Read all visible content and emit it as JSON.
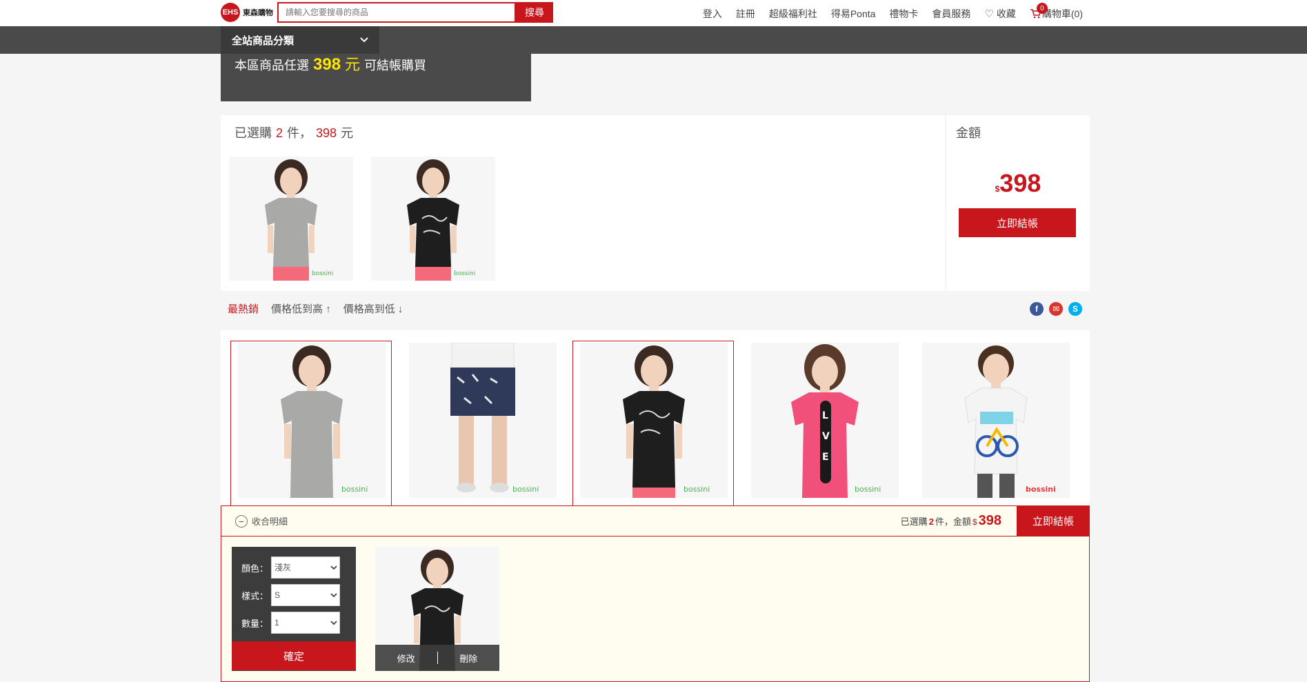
{
  "header": {
    "logo_badge": "EHS",
    "logo_text": "東森購物",
    "search_placeholder": "請輸入您要搜尋的商品",
    "search_button": "搜尋",
    "nav": [
      "登入",
      "註冊",
      "超級福利社",
      "得易Ponta",
      "禮物卡",
      "會員服務"
    ],
    "favorite": "收藏",
    "cart_count": "0",
    "cart_label": "購物車(0)"
  },
  "category": {
    "label": "全站商品分類"
  },
  "promo": {
    "prefix": "本區商品任選",
    "amount": "398",
    "unit": "元",
    "suffix": "可結帳購買"
  },
  "selected": {
    "prefix": "已選購",
    "count": "2",
    "count_unit": "件，",
    "total": "398",
    "total_unit": "元"
  },
  "amount_panel": {
    "label": "金額",
    "currency": "$",
    "value": "398",
    "checkout": "立即結帳"
  },
  "sort": [
    {
      "label": "最熱銷",
      "active": true
    },
    {
      "label": "價格低到高",
      "arrow": "↑",
      "active": false
    },
    {
      "label": "價格高到低",
      "arrow": "↓",
      "active": false
    }
  ],
  "share": [
    "f",
    "✉",
    "S"
  ],
  "products": [
    {
      "shirt": "#a9aaa8",
      "selected": true,
      "brand": "bossini"
    },
    {
      "shirt": "#f2f2f2",
      "selected": false,
      "brand": "bossini"
    },
    {
      "shirt": "#1e1e1e",
      "selected": true,
      "brand": "bossini"
    },
    {
      "shirt": "#f0507a",
      "selected": false,
      "brand": "bossini"
    },
    {
      "shirt": "#f4f4f4",
      "selected": false,
      "brand": "bossini"
    }
  ],
  "detail": {
    "collapse": "收合明細",
    "summary_prefix": "已選購",
    "summary_count": "2",
    "summary_mid": "件，金額",
    "summary_currency": "$",
    "summary_amount": "398",
    "checkout": "立即結帳",
    "color_label": "顏色：",
    "color_value": "淺灰",
    "style_label": "樣式：",
    "style_value": "S",
    "qty_label": "數量：",
    "qty_value": "1",
    "confirm": "確定",
    "edit": "修改",
    "delete": "刪除"
  }
}
